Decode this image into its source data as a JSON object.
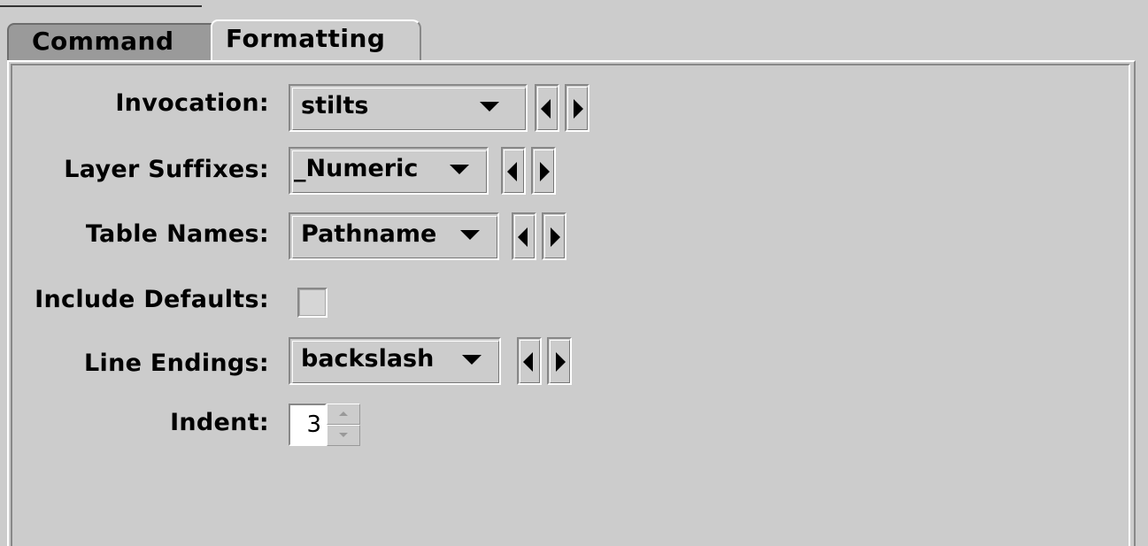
{
  "tabs": [
    {
      "label": "Command"
    },
    {
      "label": "Formatting"
    }
  ],
  "form": {
    "invocation": {
      "label": "Invocation:",
      "value": "stilts"
    },
    "layer_suffixes": {
      "label": "Layer Suffixes:",
      "value": "_Numeric"
    },
    "table_names": {
      "label": "Table Names:",
      "value": "Pathname"
    },
    "include_defaults": {
      "label": "Include Defaults:",
      "checked": false
    },
    "line_endings": {
      "label": "Line Endings:",
      "value": "backslash"
    },
    "indent": {
      "label": "Indent:",
      "value": "3"
    }
  },
  "icons": {
    "combo_arrow": "chevron-down-icon",
    "prev": "triangle-left-icon",
    "next": "triangle-right-icon"
  }
}
